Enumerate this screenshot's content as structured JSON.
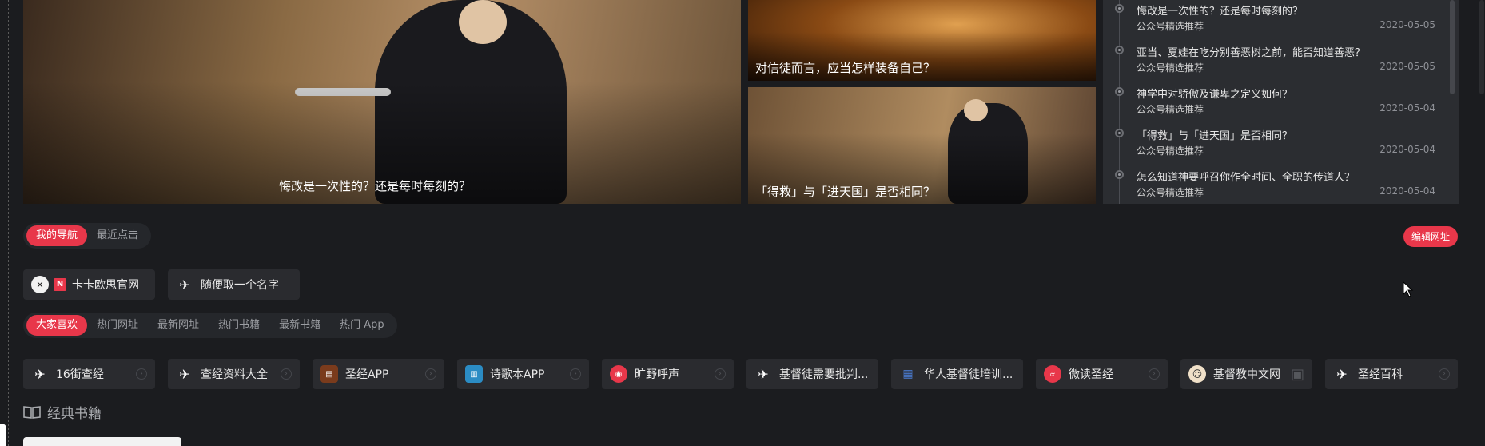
{
  "carousel": {
    "main_caption": "悔改是一次性的？还是每时每刻的？",
    "crowd_caption": "对信徒而言，应当怎样装备自己？",
    "sub_caption": "「得救」与「进天国」是否相同？"
  },
  "news": {
    "items": [
      {
        "title": "悔改是一次性的？还是每时每刻的？",
        "source": "公众号精选推荐",
        "date": "2020-05-05"
      },
      {
        "title": "亚当、夏娃在吃分别善恶树之前，能否知道善恶？",
        "source": "公众号精选推荐",
        "date": "2020-05-05"
      },
      {
        "title": "神学中对骄傲及谦卑之定义如何？",
        "source": "公众号精选推荐",
        "date": "2020-05-04"
      },
      {
        "title": "「得救」与「进天国」是否相同？",
        "source": "公众号精选推荐",
        "date": "2020-05-04"
      },
      {
        "title": "怎么知道神要呼召你作全时间、全职的传道人？",
        "source": "公众号精选推荐",
        "date": "2020-05-04"
      }
    ]
  },
  "nav": {
    "tabs": [
      "我的导航",
      "最近点击"
    ],
    "edit_label": "编辑网址"
  },
  "my_sites": [
    {
      "name": "卡卡欧思官网",
      "badge": "N",
      "icon": "kaka-logo-icon"
    },
    {
      "name": "随便取一个名字",
      "icon": "globe-icon"
    }
  ],
  "hot": {
    "tabs": [
      "大家喜欢",
      "热门网址",
      "最新网址",
      "热门书籍",
      "最新书籍",
      "热门 App"
    ]
  },
  "hot_sites": [
    {
      "name": "16街查经",
      "icon": "globe-icon",
      "color": "#2a2b2f"
    },
    {
      "name": "查经资料大全",
      "icon": "globe-icon",
      "color": "#2a2b2f"
    },
    {
      "name": "圣经APP",
      "icon": "bible-app-icon",
      "color": "#7a3b1c"
    },
    {
      "name": "诗歌本APP",
      "icon": "hymn-app-icon",
      "color": "#2b8cc4"
    },
    {
      "name": "旷野呼声",
      "icon": "voice-icon",
      "color": "#e8374a"
    },
    {
      "name": "基督徒需要批判...",
      "icon": "globe-icon",
      "color": "#2a2b2f"
    },
    {
      "name": "华人基督徒培训...",
      "icon": "grid-icon",
      "color": "#2a2b2f"
    },
    {
      "name": "微读圣经",
      "icon": "fish-icon",
      "color": "#e8374a"
    },
    {
      "name": "基督教中文网",
      "icon": "face-icon",
      "color": "#f0e0c8"
    },
    {
      "name": "圣经百科",
      "icon": "globe-icon",
      "color": "#2a2b2f"
    }
  ],
  "books": {
    "title": "经典书籍"
  }
}
